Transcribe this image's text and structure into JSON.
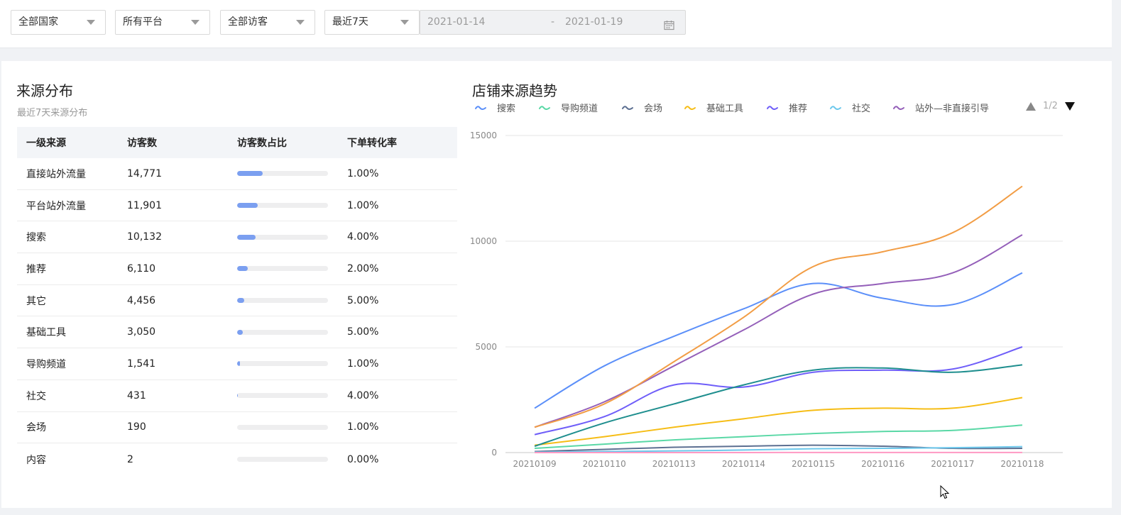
{
  "filters": {
    "country": "全部国家",
    "platform": "所有平台",
    "visitor": "全部访客",
    "period": "最近7天",
    "start_date": "2021-01-14",
    "separator": "-",
    "end_date": "2021-01-19"
  },
  "source_dist": {
    "title": "来源分布",
    "subtitle": "最近7天来源分布",
    "headers": [
      "一级来源",
      "访客数",
      "访客数占比",
      "下单转化率"
    ],
    "rows": [
      {
        "source": "直接站外流量",
        "visitors": "14,771",
        "share": 0.28,
        "conv": "1.00%"
      },
      {
        "source": "平台站外流量",
        "visitors": "11,901",
        "share": 0.23,
        "conv": "1.00%"
      },
      {
        "source": "搜索",
        "visitors": "10,132",
        "share": 0.2,
        "conv": "4.00%"
      },
      {
        "source": "推荐",
        "visitors": "6,110",
        "share": 0.12,
        "conv": "2.00%"
      },
      {
        "source": "其它",
        "visitors": "4,456",
        "share": 0.08,
        "conv": "5.00%"
      },
      {
        "source": "基础工具",
        "visitors": "3,050",
        "share": 0.06,
        "conv": "5.00%"
      },
      {
        "source": "导购频道",
        "visitors": "1,541",
        "share": 0.03,
        "conv": "1.00%"
      },
      {
        "source": "社交",
        "visitors": "431",
        "share": 0.01,
        "conv": "4.00%"
      },
      {
        "source": "会场",
        "visitors": "190",
        "share": 0.0,
        "conv": "1.00%"
      },
      {
        "source": "内容",
        "visitors": "2",
        "share": 0.0,
        "conv": "0.00%"
      }
    ]
  },
  "trend": {
    "title": "店铺来源趋势",
    "pager": "1/2"
  },
  "chart_data": {
    "type": "line",
    "x": [
      "20210109",
      "20210110",
      "20210113",
      "20210114",
      "20210115",
      "20210116",
      "20210117",
      "20210118"
    ],
    "ylim": [
      0,
      15000
    ],
    "yticks": [
      0,
      5000,
      10000,
      15000
    ],
    "grid": true,
    "legend_position": "top",
    "series": [
      {
        "name": "搜索",
        "color": "#5b8ff9",
        "legend": true,
        "values": [
          2100,
          4100,
          5500,
          6800,
          8000,
          7300,
          7000,
          8500
        ]
      },
      {
        "name": "导购频道",
        "color": "#5ad8a6",
        "legend": true,
        "values": [
          200,
          400,
          600,
          750,
          900,
          1000,
          1050,
          1300
        ]
      },
      {
        "name": "会场",
        "color": "#5d7092",
        "legend": true,
        "values": [
          50,
          150,
          250,
          300,
          350,
          300,
          200,
          200
        ]
      },
      {
        "name": "基础工具",
        "color": "#f6bd16",
        "legend": true,
        "values": [
          350,
          750,
          1200,
          1600,
          2000,
          2100,
          2100,
          2600
        ]
      },
      {
        "name": "推荐",
        "color": "#6f5ef9",
        "legend": true,
        "values": [
          850,
          1700,
          3200,
          3100,
          3800,
          3900,
          3950,
          5000
        ]
      },
      {
        "name": "社交",
        "color": "#6dc8ec",
        "legend": true,
        "values": [
          20,
          50,
          80,
          120,
          180,
          200,
          230,
          280
        ]
      },
      {
        "name": "站外—非直接引导",
        "color": "#945fb9",
        "legend": true,
        "values": [
          1200,
          2400,
          4100,
          5800,
          7500,
          8000,
          8500,
          10300
        ]
      },
      {
        "color": "#f29d45",
        "legend": false,
        "values": [
          1200,
          2300,
          4300,
          6400,
          8800,
          9500,
          10400,
          12600
        ]
      },
      {
        "color": "#1e8e8e",
        "legend": false,
        "values": [
          300,
          1400,
          2300,
          3200,
          3900,
          4000,
          3800,
          4150
        ]
      },
      {
        "color": "#ff99c3",
        "legend": false,
        "values": [
          0,
          0,
          0,
          0,
          5,
          5,
          5,
          5
        ]
      }
    ]
  }
}
